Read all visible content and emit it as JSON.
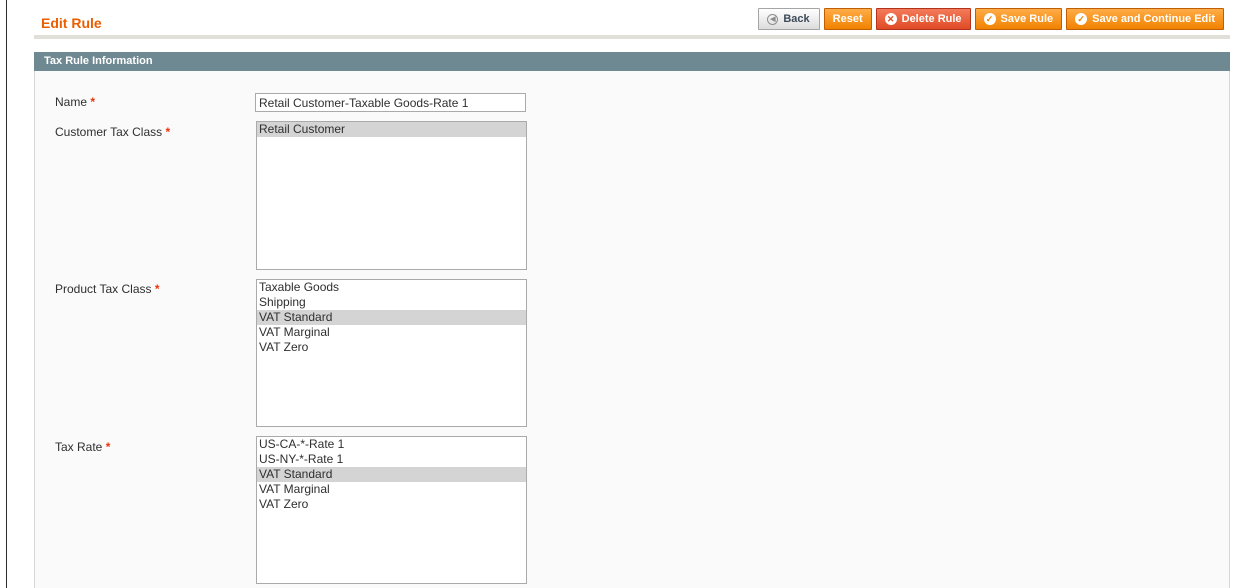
{
  "page": {
    "title": "Edit Rule"
  },
  "buttons": {
    "back": "Back",
    "reset": "Reset",
    "delete": "Delete Rule",
    "save": "Save Rule",
    "save_continue": "Save and Continue Edit"
  },
  "fieldset": {
    "title": "Tax Rule Information"
  },
  "form": {
    "required_mark": "*",
    "name": {
      "label": "Name",
      "value": "Retail Customer-Taxable Goods-Rate 1"
    },
    "customer_tax_class": {
      "label": "Customer Tax Class",
      "options": [
        "Retail Customer"
      ],
      "selected": [
        "Retail Customer"
      ]
    },
    "product_tax_class": {
      "label": "Product Tax Class",
      "options": [
        "Taxable Goods",
        "Shipping",
        "VAT Standard",
        "VAT Marginal",
        "VAT Zero"
      ],
      "selected": [
        "VAT Standard"
      ]
    },
    "tax_rate": {
      "label": "Tax Rate",
      "options": [
        "US-CA-*-Rate 1",
        "US-NY-*-Rate 1",
        "VAT Standard",
        "VAT Marginal",
        "VAT Zero"
      ],
      "selected": [
        "VAT Standard"
      ]
    }
  },
  "colors": {
    "accent": "#eb5e00",
    "header_bar": "#6f8992",
    "button_orange": "#f18200",
    "button_red": "#e04a26",
    "selected_option": "#d4d4d4"
  },
  "icons": {
    "back": "back-arrow-icon",
    "delete": "delete-x-icon",
    "save": "checkmark-icon"
  }
}
